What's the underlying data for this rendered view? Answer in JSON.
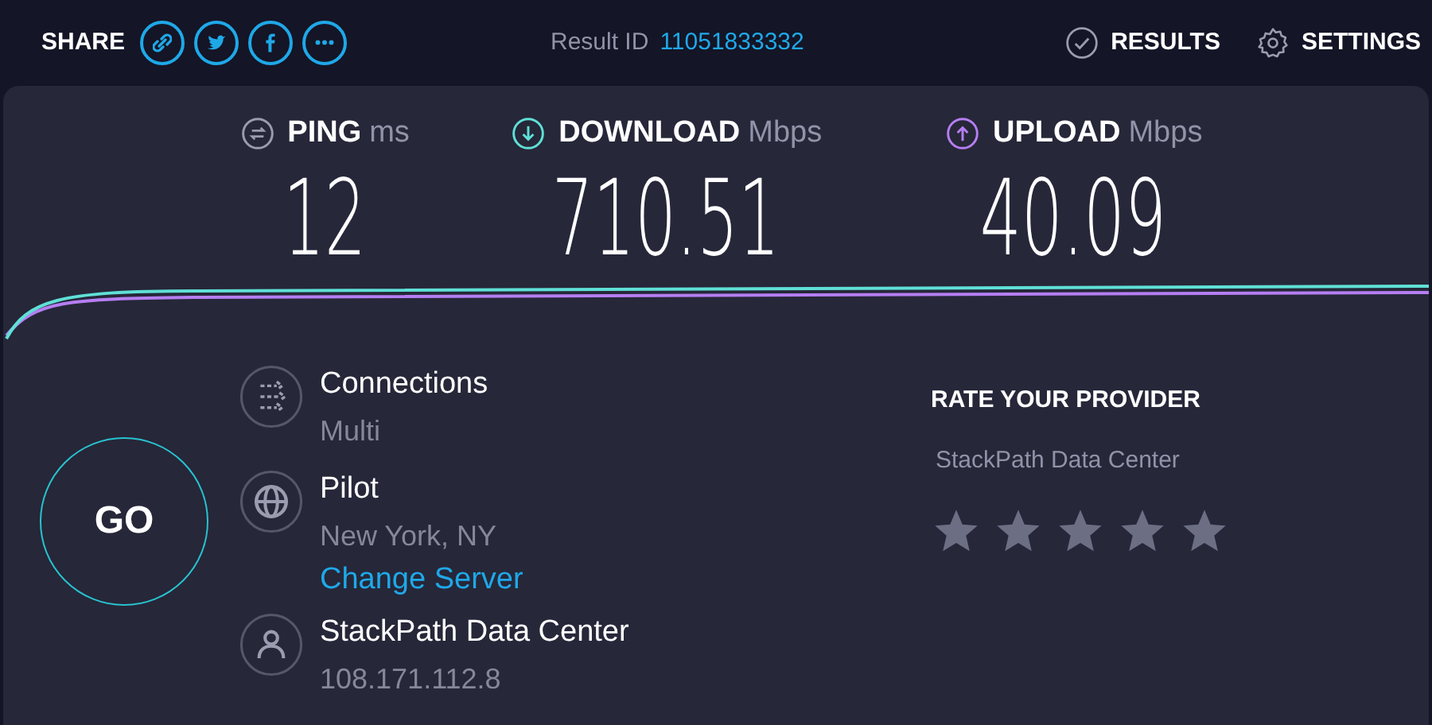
{
  "header": {
    "share_label": "SHARE",
    "share_icons": [
      {
        "kind": "link"
      },
      {
        "kind": "twitter"
      },
      {
        "kind": "facebook"
      },
      {
        "kind": "more"
      }
    ],
    "result_label": "Result ID",
    "result_id": "11051833332",
    "nav": [
      {
        "kind": "results",
        "label": "RESULTS"
      },
      {
        "kind": "settings",
        "label": "SETTINGS"
      }
    ]
  },
  "metrics": [
    {
      "kind": "ping",
      "label": "PING",
      "unit": "ms",
      "value": "12"
    },
    {
      "kind": "download",
      "label": "DOWNLOAD",
      "unit": "Mbps",
      "value": "710.51"
    },
    {
      "kind": "upload",
      "label": "UPLOAD",
      "unit": "Mbps",
      "value": "40.09"
    }
  ],
  "go_button": "GO",
  "details": [
    {
      "kind": "connections",
      "title": "Connections",
      "lines": [
        "Multi"
      ]
    },
    {
      "kind": "server",
      "title": "Pilot",
      "lines": [
        "New York, NY"
      ],
      "link": "Change Server"
    },
    {
      "kind": "provider",
      "title": "StackPath Data Center",
      "lines": [
        "108.171.112.8"
      ]
    }
  ],
  "rating": {
    "title": "RATE YOUR PROVIDER",
    "provider": "StackPath Data Center"
  }
}
